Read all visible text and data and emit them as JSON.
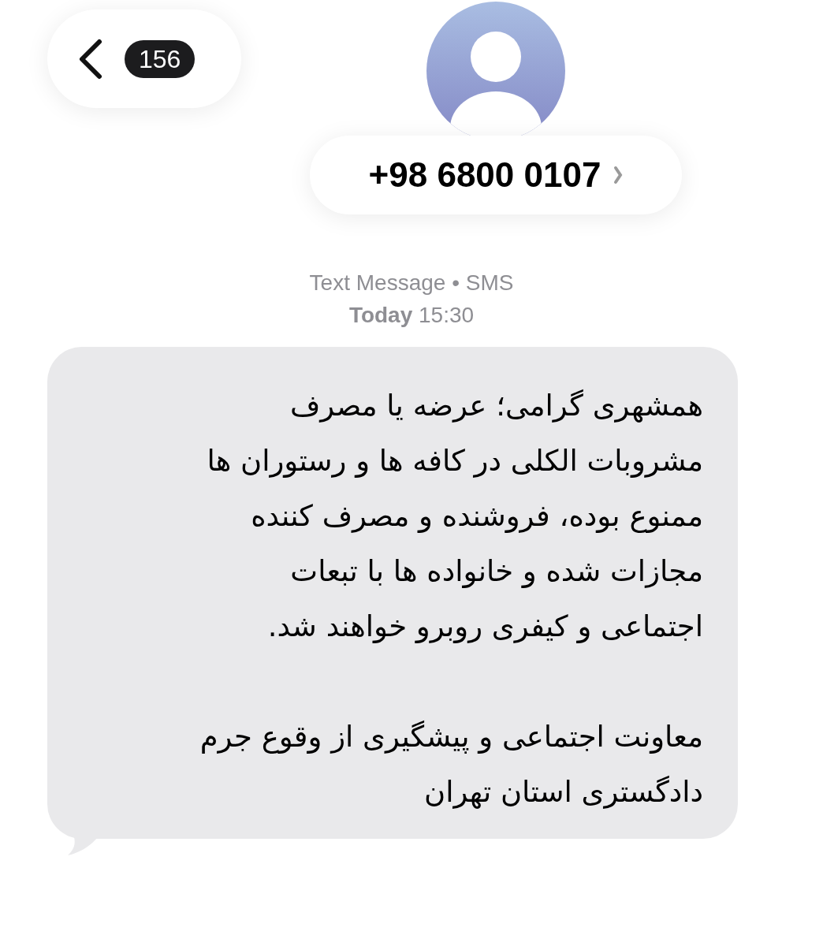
{
  "header": {
    "unread_count": "156",
    "contact": "+98 6800 0107"
  },
  "meta": {
    "service": "Text Message • SMS",
    "day": "Today",
    "time": "15:30"
  },
  "message": {
    "paragraphs": [
      "همشهری گرامی؛ عرضه یا مصرف\nمشروبات الکلی در کافه ها و رستوران ها\nممنوع بوده، فروشنده و مصرف کننده\nمجازات شده و خانواده ها با تبعات\nاجتماعی و کیفری روبرو خواهند شد.",
      "معاونت اجتماعی و پیشگیری از وقوع جرم\nدادگستری استان تهران"
    ]
  }
}
